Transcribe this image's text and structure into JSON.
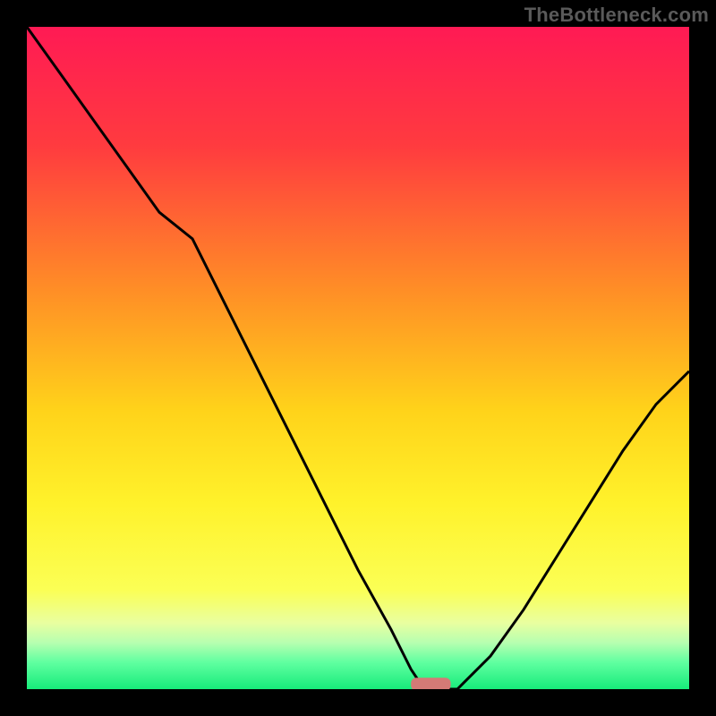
{
  "watermark": "TheBottleneck.com",
  "colors": {
    "background": "#000000",
    "watermark_text": "#5a5a5a",
    "curve_stroke": "#000000",
    "marker_fill": "#d47a76",
    "gradient_stops": [
      {
        "offset": "0%",
        "color": "#ff1a54"
      },
      {
        "offset": "18%",
        "color": "#ff3b3f"
      },
      {
        "offset": "40%",
        "color": "#ff8f26"
      },
      {
        "offset": "58%",
        "color": "#ffd31a"
      },
      {
        "offset": "72%",
        "color": "#fff22b"
      },
      {
        "offset": "85%",
        "color": "#fbff55"
      },
      {
        "offset": "90%",
        "color": "#e9ffa0"
      },
      {
        "offset": "93%",
        "color": "#b6ffb0"
      },
      {
        "offset": "96%",
        "color": "#5fffa0"
      },
      {
        "offset": "100%",
        "color": "#17eb7a"
      }
    ]
  },
  "chart_data": {
    "type": "line",
    "title": "",
    "xlabel": "",
    "ylabel": "",
    "xlim": [
      0,
      100
    ],
    "ylim": [
      0,
      100
    ],
    "x": [
      0,
      5,
      10,
      15,
      20,
      25,
      30,
      35,
      40,
      45,
      50,
      55,
      58,
      60,
      62,
      65,
      70,
      75,
      80,
      85,
      90,
      95,
      100
    ],
    "y": [
      100,
      93,
      86,
      79,
      72,
      68,
      58,
      48,
      38,
      28,
      18,
      9,
      3,
      0,
      0,
      0,
      5,
      12,
      20,
      28,
      36,
      43,
      48
    ],
    "marker": {
      "center_x": 61,
      "y": 0,
      "width_x": 6,
      "height_y": 2
    },
    "note": "Curve descends steeply from upper-left with a slight convex bend near x≈25, reaches zero around x≈58–65 (flat segment), then rises toward upper-right reaching ≈48% at x=100. Small rounded pink marker sits at the minimum."
  }
}
